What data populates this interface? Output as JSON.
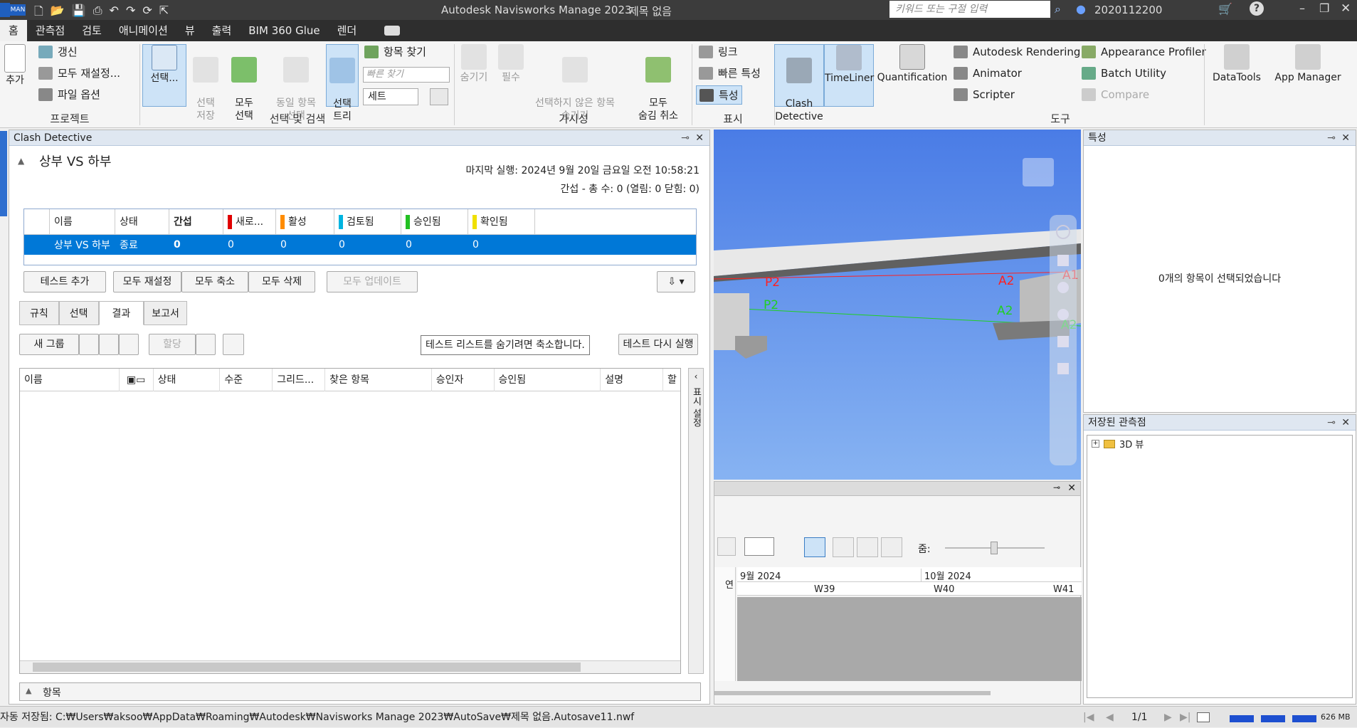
{
  "titlebar": {
    "quick_badge": "MAN",
    "app_title": "Autodesk Navisworks Manage 2023",
    "doc_title": "제목 없음",
    "search_placeholder": "키워드 또는 구절 입력",
    "user": "2020112200"
  },
  "tabs": [
    "홈",
    "관측점",
    "검토",
    "애니메이션",
    "뷰",
    "출력",
    "BIM 360 Glue",
    "렌더"
  ],
  "ribbon": {
    "project": {
      "add": "추가",
      "refresh": "갱신",
      "reset_all": "모두 재설정...",
      "file_options": "파일 옵션",
      "group": "프로젝트"
    },
    "select": {
      "select": "선택...",
      "save_selection": "선택\n저장",
      "select_all": "모두\n선택",
      "same_items": "동일 항목\n선택",
      "selection_tree": "선택\n트리",
      "find_items": "항목 찾기",
      "quick_find_placeholder": "빠른 찾기",
      "sets": "세트",
      "group": "선택 및 검색"
    },
    "visibility": {
      "hide": "숨기기",
      "required": "필수",
      "hide_unselected": "선택하지 않은 항목\n숨기기",
      "unhide_all": "모두\n숨김 취소",
      "group": "가시성"
    },
    "display": {
      "links": "링크",
      "quick_props": "빠른 특성",
      "properties": "특성",
      "group": "표시"
    },
    "tools": {
      "clash": "Clash\nDetective",
      "timeliner": "TimeLiner",
      "quantification": "Quantification",
      "rendering": "Autodesk Rendering",
      "animator": "Animator",
      "scripter": "Scripter",
      "appearance": "Appearance Profiler",
      "batch": "Batch Utility",
      "compare": "Compare",
      "datatools": "DataTools",
      "appmanager": "App Manager",
      "group": "도구"
    }
  },
  "clash": {
    "panel_title": "Clash Detective",
    "test_name": "상부 VS 하부",
    "last_run": "마지막 실행: 2024년 9월 20일 금요일 오전 10:58:21",
    "summary": "간섭 - 총 수: 0 (열림: 0 닫힘: 0)",
    "columns": [
      "이름",
      "상태",
      "간섭",
      "새로...",
      "활성",
      "검토됨",
      "승인됨",
      "확인됨"
    ],
    "row": [
      "상부 VS 하부",
      "종료",
      "0",
      "0",
      "0",
      "0",
      "0",
      "0"
    ],
    "buttons": {
      "add_test": "테스트 추가",
      "reset_all": "모두 재설정",
      "compact_all": "모두 축소",
      "delete_all": "모두 삭제",
      "update_all": "모두 업데이트"
    },
    "subtabs": [
      "규칙",
      "선택",
      "결과",
      "보고서"
    ],
    "new_group": "새 그룹",
    "assign": "할당",
    "tooltip": "테스트 리스트를 숨기려면 축소합니다.",
    "rerun": "테스트 다시 실행",
    "result_columns": [
      "이름",
      "상태",
      "수준",
      "그리드...",
      "찾은 항목",
      "승인자",
      "승인됨",
      "설명",
      "할"
    ],
    "display_settings": "표시 설정",
    "items_label": "항목"
  },
  "viewport": {
    "labels": [
      "P2",
      "A2",
      "A1",
      "P2",
      "A2",
      "A2"
    ]
  },
  "timeline": {
    "zoom_label": "줌:",
    "months": [
      "9월 2024",
      "10월 2024"
    ],
    "weeks": [
      "W39",
      "W40",
      "W41"
    ],
    "col_label": "연"
  },
  "properties": {
    "title": "특성",
    "empty": "0개의 항목이 선택되었습니다"
  },
  "viewpoints": {
    "title": "저장된 관측점",
    "item": "3D 뷰"
  },
  "status": {
    "autosave": "자동 저장됨: C:₩Users₩aksoo₩AppData₩Roaming₩Autodesk₩Navisworks Manage 2023₩AutoSave₩제목 없음.Autosave11.nwf",
    "page": "1/1",
    "memory": "626 MB"
  },
  "colors": {
    "accent": "#0078d7",
    "new": "#e00000",
    "active": "#ff8c00",
    "reviewed": "#00b4e0",
    "approved": "#22c022",
    "resolved": "#f0e000"
  }
}
